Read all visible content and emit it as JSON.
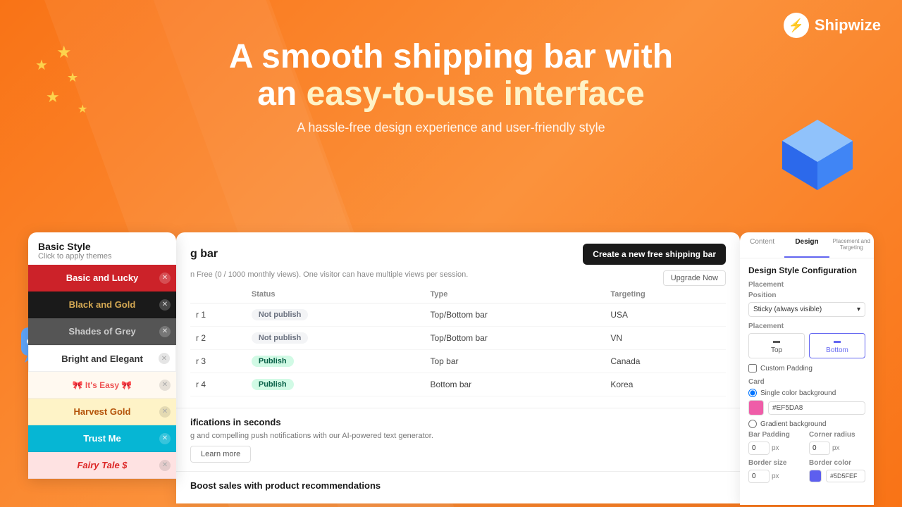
{
  "logo": {
    "icon": "⚡",
    "text": "Shipwize"
  },
  "header": {
    "line1": "A smooth shipping bar with",
    "line2a": "an ",
    "line2b": "easy-to-use interface",
    "subtitle": "A hassle-free design experience and user-friendly style"
  },
  "basic_style_panel": {
    "title": "Basic Style",
    "subtitle": "Click to apply themes",
    "themes": [
      {
        "id": "basic-lucky",
        "label": "Basic and Lucky",
        "style": "basic"
      },
      {
        "id": "black-gold",
        "label": "Black and Gold",
        "style": "black"
      },
      {
        "id": "shades-grey",
        "label": "Shades of Grey",
        "style": "grey"
      },
      {
        "id": "bright-elegant",
        "label": "Bright and Elegant",
        "style": "bright"
      },
      {
        "id": "its-easy",
        "label": "🎀 It's Easy 🎀",
        "style": "easy"
      },
      {
        "id": "harvest-gold",
        "label": "Harvest Gold",
        "style": "harvest"
      },
      {
        "id": "trust-me",
        "label": "Trust Me",
        "style": "trust"
      },
      {
        "id": "fairy-tale",
        "label": "Fairy Tale $",
        "style": "fairy"
      }
    ]
  },
  "dashboard": {
    "section_title": "g bar",
    "info_text": "n Free (0 / 1000 monthly views). One visitor can have multiple views per session.",
    "create_btn": "Create a new free shipping bar",
    "upgrade_btn": "Upgrade Now",
    "table": {
      "columns": [
        "",
        "Status",
        "Type",
        "Targeting"
      ],
      "rows": [
        {
          "name": "r 1",
          "status": "Not publish",
          "type": "Top/Bottom bar",
          "targeting": "USA",
          "published": false
        },
        {
          "name": "r 2",
          "status": "Not publish",
          "type": "Top/Bottom bar",
          "targeting": "VN",
          "published": false
        },
        {
          "name": "r 3",
          "status": "Publish",
          "type": "Top bar",
          "targeting": "Canada",
          "published": true
        },
        {
          "name": "r 4",
          "status": "Publish",
          "type": "Bottom bar",
          "targeting": "Korea",
          "published": true
        }
      ]
    },
    "notifications_title": "ifications in seconds",
    "notifications_text": "g and compelling push notifications with our AI-powered text generator.",
    "learn_more": "Learn more",
    "boost_title": "Boost sales with product recommendations"
  },
  "design_panel": {
    "tabs": [
      "Content",
      "Design",
      "Placement and Targeting"
    ],
    "active_tab": "Design",
    "section_title": "Design Style Configuration",
    "placement": {
      "label": "Placement",
      "position_label": "Position",
      "position_value": "Sticky (always visible)",
      "placement_label": "Placement",
      "top_btn": "Top",
      "bottom_btn": "Bottom",
      "custom_padding": "Custom Padding"
    },
    "card": {
      "label": "Card",
      "single_color": "Single color background",
      "color_value": "#EF5DA8",
      "gradient": "Gradient background"
    },
    "bar_padding": {
      "label": "Bar Padding",
      "value": "0",
      "unit": "px"
    },
    "corner_radius": {
      "label": "Corner radius",
      "value": "0",
      "unit": "px"
    },
    "border_size": {
      "label": "Border size",
      "value": "0",
      "unit": "px"
    },
    "border_color": {
      "label": "Border color",
      "value": "#5D5FEF"
    }
  }
}
